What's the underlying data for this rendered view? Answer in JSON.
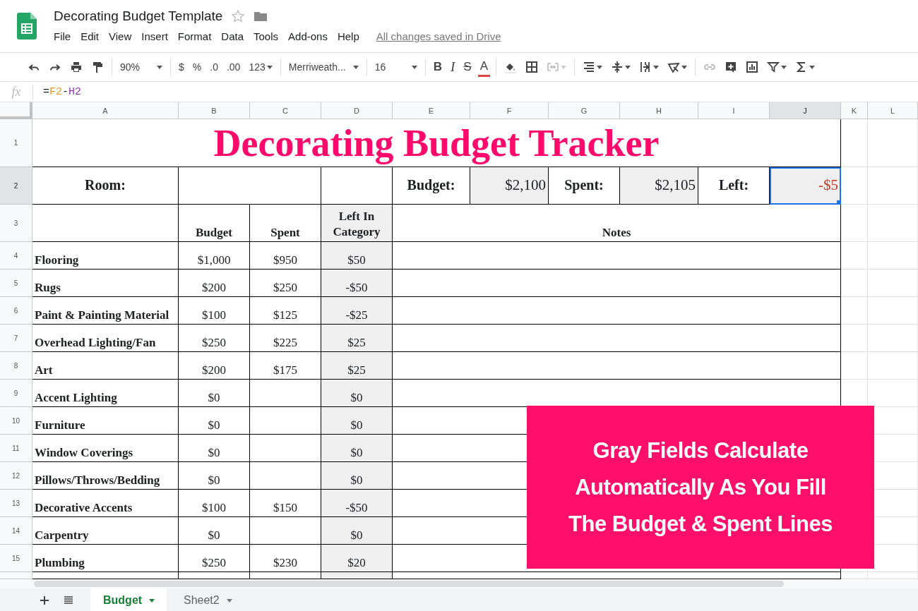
{
  "window": {
    "title": "Decorating Budget Template"
  },
  "menu": [
    "File",
    "Edit",
    "View",
    "Insert",
    "Format",
    "Data",
    "Tools",
    "Add-ons",
    "Help"
  ],
  "save_status": "All changes saved in Drive",
  "toolbar": {
    "groups": [
      [
        {
          "kind": "undo",
          "disabled": false
        },
        {
          "kind": "redo",
          "disabled": false
        },
        {
          "kind": "print",
          "disabled": false
        },
        {
          "kind": "paint",
          "disabled": false
        }
      ],
      [
        {
          "kind": "select",
          "label": "90%",
          "disabled": false
        }
      ],
      [
        {
          "kind": "text",
          "label": "$",
          "disabled": false
        },
        {
          "kind": "text",
          "label": "%",
          "disabled": false
        },
        {
          "kind": "text",
          "label": ".0",
          "disabled": false
        },
        {
          "kind": "text",
          "label": ".00",
          "disabled": false
        },
        {
          "kind": "text",
          "label": "123",
          "caret": true,
          "disabled": false
        }
      ],
      [
        {
          "kind": "select",
          "label": "Merriweath...",
          "disabled": false
        }
      ],
      [
        {
          "kind": "select",
          "label": "16",
          "disabled": false
        }
      ],
      [
        {
          "kind": "bold",
          "label": "B",
          "disabled": false
        },
        {
          "kind": "italic",
          "label": "I",
          "disabled": false
        },
        {
          "kind": "strike",
          "label": "S",
          "disabled": false
        },
        {
          "kind": "textcolor",
          "label": "A",
          "disabled": false
        }
      ],
      [
        {
          "kind": "fill",
          "disabled": false
        },
        {
          "kind": "borders",
          "disabled": false
        },
        {
          "kind": "merge",
          "caret": true,
          "disabled": true
        }
      ],
      [
        {
          "kind": "align",
          "caret": true,
          "disabled": false
        },
        {
          "kind": "valign",
          "caret": true,
          "disabled": false
        },
        {
          "kind": "wrap",
          "caret": true,
          "disabled": false
        },
        {
          "kind": "rotate",
          "caret": true,
          "disabled": false
        }
      ],
      [
        {
          "kind": "link",
          "disabled": true
        },
        {
          "kind": "comment",
          "disabled": false
        },
        {
          "kind": "chart",
          "disabled": false
        },
        {
          "kind": "filter",
          "caret": true,
          "disabled": false
        },
        {
          "kind": "sum",
          "caret": true,
          "disabled": false
        }
      ]
    ]
  },
  "formula_bar": {
    "fx": "fx",
    "tokens": [
      {
        "text": "=",
        "color": "#202124"
      },
      {
        "text": "F2",
        "color": "#e69a28"
      },
      {
        "text": "-",
        "color": "#202124"
      },
      {
        "text": "H2",
        "color": "#8e3cac"
      }
    ]
  },
  "columns": [
    {
      "label": "A",
      "selected": false
    },
    {
      "label": "B",
      "selected": false
    },
    {
      "label": "C",
      "selected": false
    },
    {
      "label": "D",
      "selected": false
    },
    {
      "label": "E",
      "selected": false
    },
    {
      "label": "F",
      "selected": false
    },
    {
      "label": "G",
      "selected": false
    },
    {
      "label": "H",
      "selected": false
    },
    {
      "label": "I",
      "selected": false
    },
    {
      "label": "J",
      "selected": true
    },
    {
      "label": "K",
      "selected": false
    },
    {
      "label": "L",
      "selected": false
    }
  ],
  "title_row": {
    "number": "1",
    "selected": false,
    "title": "Decorating Budget Tracker"
  },
  "summary_row": {
    "number": "2",
    "selected": true,
    "room_label": "Room:",
    "budget_label": "Budget:",
    "budget": "$2,100",
    "spent_label": "Spent:",
    "spent": "$2,105",
    "left_label": "Left:",
    "left": "-$5",
    "left_selected": true
  },
  "header_row": {
    "number": "3",
    "selected": false,
    "budget": "Budget",
    "spent": "Spent",
    "left": "Left In Category",
    "notes": "Notes"
  },
  "item_rows": [
    {
      "number": "4",
      "selected": false,
      "category": "Flooring",
      "budget": "$1,000",
      "spent": "$950",
      "left": "$50"
    },
    {
      "number": "5",
      "selected": false,
      "category": "Rugs",
      "budget": "$200",
      "spent": "$250",
      "left": "-$50"
    },
    {
      "number": "6",
      "selected": false,
      "category": "Paint & Painting Material",
      "budget": "$100",
      "spent": "$125",
      "left": "-$25"
    },
    {
      "number": "7",
      "selected": false,
      "category": "Overhead Lighting/Fan",
      "budget": "$250",
      "spent": "$225",
      "left": "$25"
    },
    {
      "number": "8",
      "selected": false,
      "category": "Art",
      "budget": "$200",
      "spent": "$175",
      "left": "$25"
    },
    {
      "number": "9",
      "selected": false,
      "category": "Accent Lighting",
      "budget": "$0",
      "left": "$0"
    },
    {
      "number": "10",
      "selected": false,
      "category": "Furniture",
      "budget": "$0",
      "left": "$0"
    },
    {
      "number": "11",
      "selected": false,
      "category": "Window Coverings",
      "budget": "$0",
      "left": "$0"
    },
    {
      "number": "12",
      "selected": false,
      "category": "Pillows/Throws/Bedding",
      "budget": "$0",
      "left": "$0"
    },
    {
      "number": "13",
      "selected": false,
      "category": "Decorative Accents",
      "budget": "$100",
      "spent": "$150",
      "left": "-$50"
    },
    {
      "number": "14",
      "selected": false,
      "category": "Carpentry",
      "budget": "$0",
      "left": "$0"
    },
    {
      "number": "15",
      "selected": false,
      "category": "Plumbing",
      "budget": "$250",
      "spent": "$230",
      "left": "$20"
    }
  ],
  "sheet_tabs": [
    {
      "label": "Budget",
      "selected": true
    },
    {
      "label": "Sheet2",
      "selected": false
    }
  ],
  "callout": {
    "lines": [
      "Gray Fields Calculate",
      "Automatically As You Fill",
      "The Budget & Spent Lines"
    ]
  }
}
